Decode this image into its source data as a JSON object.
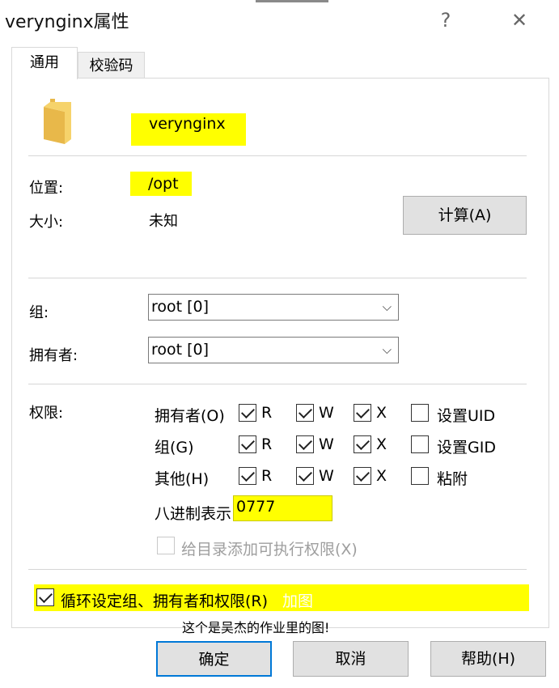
{
  "window": {
    "title": "verynginx属性",
    "help_symbol": "?",
    "close_symbol": "✕"
  },
  "tabs": [
    {
      "label": "通用",
      "active": true
    },
    {
      "label": "校验码",
      "active": false
    }
  ],
  "file": {
    "icon": "folder-icon",
    "name": "verynginx",
    "location_label": "位置:",
    "location_value": "/opt",
    "size_label": "大小:",
    "size_value": "未知",
    "calc_button": "计算(A)"
  },
  "ownership": {
    "group_label": "组:",
    "group_value": "root [0]",
    "owner_label": "拥有者:",
    "owner_value": "root [0]"
  },
  "permissions": {
    "label": "权限:",
    "rows": [
      {
        "name": "拥有者(O)",
        "r": true,
        "w": true,
        "x": true,
        "special": "设置UID",
        "special_checked": false
      },
      {
        "name": "组(G)",
        "r": true,
        "w": true,
        "x": true,
        "special": "设置GID",
        "special_checked": false
      },
      {
        "name": "其他(H)",
        "r": true,
        "w": true,
        "x": true,
        "special": "粘附",
        "special_checked": false
      }
    ],
    "r_label": "R",
    "w_label": "W",
    "x_label": "X",
    "octal_label": "八进制表示",
    "octal_value": "0777",
    "exec_dirs_label": "给目录添加可执行权限(X)",
    "exec_dirs_checked": false
  },
  "recursive": {
    "label": "循环设定组、拥有者和权限(R)",
    "checked": true,
    "overlay_text": "加图"
  },
  "note": "这个是吴杰的作业里的图!",
  "buttons": {
    "ok": "确定",
    "cancel": "取消",
    "help": "帮助(H)"
  },
  "colors": {
    "highlight": "#ffff00",
    "focus": "#0078d7"
  }
}
